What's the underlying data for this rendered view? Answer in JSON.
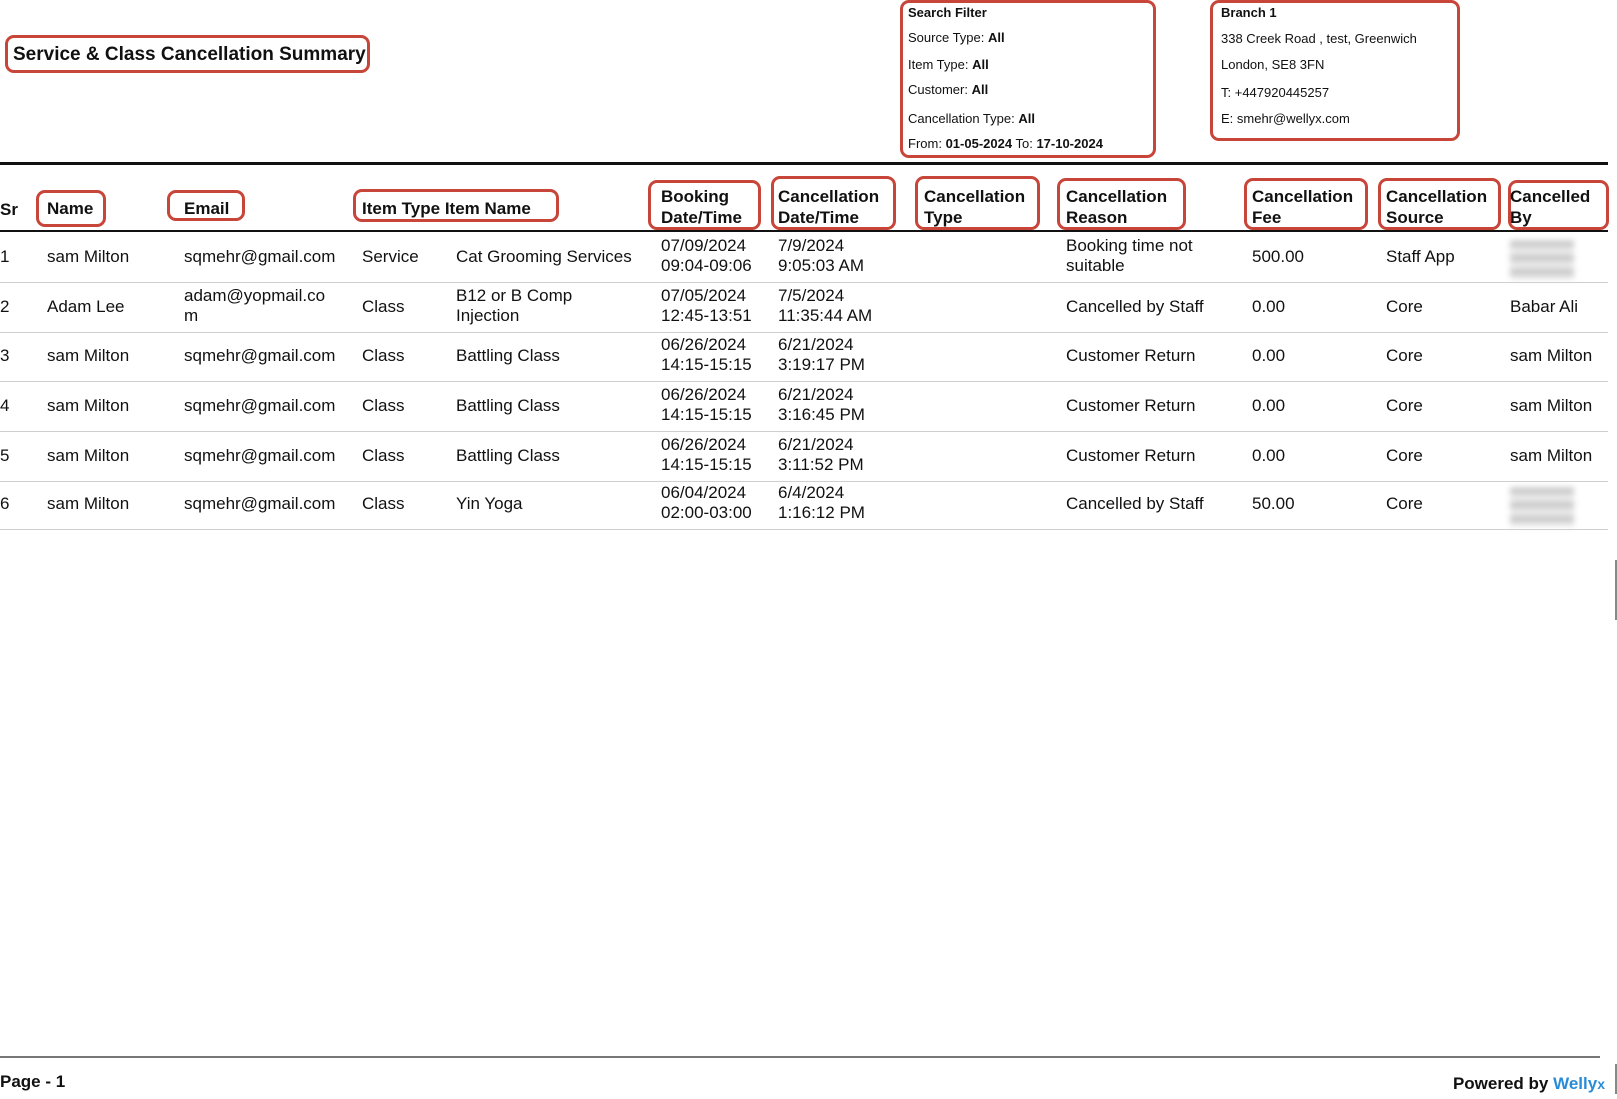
{
  "report": {
    "title": "Service & Class Cancellation Summary"
  },
  "filter": {
    "heading": "Search Filter",
    "source_type_label": "Source Type:",
    "source_type_value": "All",
    "item_type_label": "Item Type:",
    "item_type_value": "All",
    "customer_label": "Customer:",
    "customer_value": "All",
    "cancellation_type_label": "Cancellation Type:",
    "cancellation_type_value": "All",
    "from_label": "From:",
    "from_value": "01-05-2024",
    "to_label": "To:",
    "to_value": "17-10-2024"
  },
  "branch": {
    "name": "Branch 1",
    "address_line1": "338 Creek Road , test, Greenwich",
    "address_line2": "London, SE8 3FN",
    "phone": "T: +447920445257",
    "email": "E: smehr@wellyx.com"
  },
  "table": {
    "headers": {
      "sr": "Sr",
      "name": "Name",
      "email": "Email",
      "item_type_item_name": "Item Type Item Name",
      "booking_1": "Booking",
      "booking_2": "Date/Time",
      "cancel_dt_1": "Cancellation",
      "cancel_dt_2": "Date/Time",
      "cancel_type_1": "Cancellation",
      "cancel_type_2": "Type",
      "cancel_reason_1": "Cancellation",
      "cancel_reason_2": "Reason",
      "cancel_fee_1": "Cancellation",
      "cancel_fee_2": "Fee",
      "cancel_source_1": "Cancellation",
      "cancel_source_2": "Source",
      "cancelled_by_1": "Cancelled",
      "cancelled_by_2": "By"
    },
    "rows": [
      {
        "sr": "1",
        "name": "sam Milton",
        "email_1": "sqmehr@gmail.com",
        "email_2": "",
        "item_type": "Service",
        "item_name_1": "Cat Grooming Services",
        "item_name_2": "",
        "booking_date": "07/09/2024",
        "booking_time": "09:04-09:06",
        "cancel_date": "7/9/2024",
        "cancel_time": "9:05:03 AM",
        "cancel_type": "",
        "reason_1": "Booking time not",
        "reason_2": "suitable",
        "fee": "500.00",
        "source": "Staff App",
        "cancelled_by": ""
      },
      {
        "sr": "2",
        "name": "Adam Lee",
        "email_1": "adam@yopmail.co",
        "email_2": "m",
        "item_type": "Class",
        "item_name_1": "B12 or B Comp",
        "item_name_2": "Injection",
        "booking_date": "07/05/2024",
        "booking_time": "12:45-13:51",
        "cancel_date": "7/5/2024",
        "cancel_time": "11:35:44 AM",
        "cancel_type": "",
        "reason_1": "Cancelled by Staff",
        "reason_2": "",
        "fee": "0.00",
        "source": "Core",
        "cancelled_by": "Babar Ali"
      },
      {
        "sr": "3",
        "name": "sam Milton",
        "email_1": "sqmehr@gmail.com",
        "email_2": "",
        "item_type": "Class",
        "item_name_1": "Battling Class",
        "item_name_2": "",
        "booking_date": "06/26/2024",
        "booking_time": "14:15-15:15",
        "cancel_date": "6/21/2024",
        "cancel_time": "3:19:17 PM",
        "cancel_type": "",
        "reason_1": "Customer Return",
        "reason_2": "",
        "fee": "0.00",
        "source": "Core",
        "cancelled_by": "sam Milton"
      },
      {
        "sr": "4",
        "name": "sam Milton",
        "email_1": "sqmehr@gmail.com",
        "email_2": "",
        "item_type": "Class",
        "item_name_1": "Battling Class",
        "item_name_2": "",
        "booking_date": "06/26/2024",
        "booking_time": "14:15-15:15",
        "cancel_date": "6/21/2024",
        "cancel_time": "3:16:45 PM",
        "cancel_type": "",
        "reason_1": "Customer Return",
        "reason_2": "",
        "fee": "0.00",
        "source": "Core",
        "cancelled_by": "sam Milton"
      },
      {
        "sr": "5",
        "name": "sam Milton",
        "email_1": "sqmehr@gmail.com",
        "email_2": "",
        "item_type": "Class",
        "item_name_1": "Battling Class",
        "item_name_2": "",
        "booking_date": "06/26/2024",
        "booking_time": "14:15-15:15",
        "cancel_date": "6/21/2024",
        "cancel_time": "3:11:52 PM",
        "cancel_type": "",
        "reason_1": "Customer Return",
        "reason_2": "",
        "fee": "0.00",
        "source": "Core",
        "cancelled_by": "sam Milton"
      },
      {
        "sr": "6",
        "name": "sam Milton",
        "email_1": "sqmehr@gmail.com",
        "email_2": "",
        "item_type": "Class",
        "item_name_1": "Yin Yoga",
        "item_name_2": "",
        "booking_date": "06/04/2024",
        "booking_time": "02:00-03:00",
        "cancel_date": "6/4/2024",
        "cancel_time": "1:16:12 PM",
        "cancel_type": "",
        "reason_1": "Cancelled by Staff",
        "reason_2": "",
        "fee": "50.00",
        "source": "Core",
        "cancelled_by": ""
      }
    ]
  },
  "footer": {
    "page_label": "Page - 1",
    "powered_by": "Powered by",
    "brand": "Welly",
    "brand_tail": "x"
  },
  "colors": {
    "annotation": "#c8453a",
    "brand": "#2a8cd6"
  }
}
